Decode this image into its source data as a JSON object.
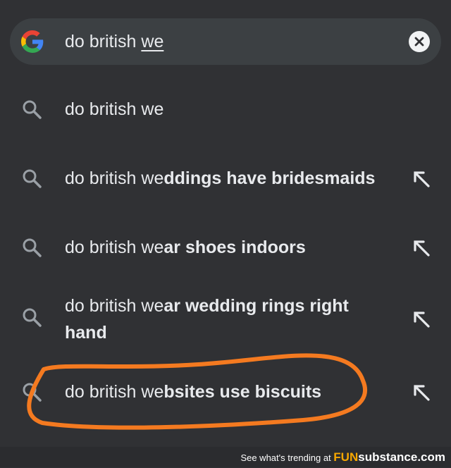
{
  "search": {
    "prefix": "do british ",
    "typed": "we"
  },
  "suggestions": [
    {
      "prefix": "do british we",
      "rest": "",
      "rest2": "",
      "has_arrow": false
    },
    {
      "prefix": "do british we",
      "rest": "ddings have bridesmaids",
      "rest2": "",
      "has_arrow": true
    },
    {
      "prefix": "do british we",
      "rest": "ar shoes indoors",
      "rest2": "",
      "has_arrow": true
    },
    {
      "prefix": "do british we",
      "rest": "ar wedding rings right",
      "rest2": "hand",
      "has_arrow": true
    },
    {
      "prefix": "do british we",
      "rest": "bsites use biscuits",
      "rest2": "",
      "has_arrow": true
    }
  ],
  "footer": {
    "tagline": "See what's trending at ",
    "brand_fun": "FUN",
    "brand_rest": "substance.com"
  },
  "colors": {
    "background": "#303134",
    "search_bar": "#3c4043",
    "text": "#e8eaed",
    "annotation": "#f47a20",
    "brand_accent": "#f7a700"
  },
  "icons": {
    "logo": "google-g-icon",
    "clear": "clear-x-icon",
    "suggestion": "magnifier-icon",
    "fill": "fill-arrow-icon"
  }
}
